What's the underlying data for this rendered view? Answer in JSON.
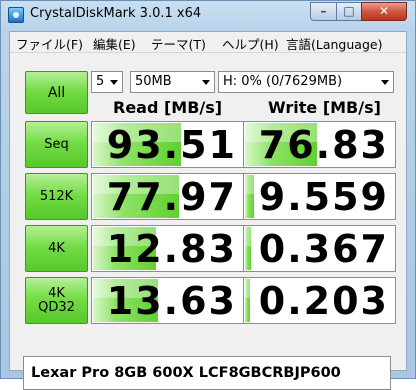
{
  "window": {
    "title": "CrystalDiskMark 3.0.1 x64"
  },
  "menu": [
    "ファイル(F)",
    "編集(E)",
    "テーマ(T)",
    "ヘルプ(H)",
    "言語(Language)"
  ],
  "controls": {
    "all_label": "All",
    "runs": "5",
    "size": "50MB",
    "drive": "H: 0% (0/7629MB)"
  },
  "headers": {
    "read": "Read [MB/s]",
    "write": "Write [MB/s]"
  },
  "tests": [
    {
      "label": "Seq",
      "read": "93.51",
      "write": "76.83",
      "read_fill": 0.58,
      "write_fill": 0.48
    },
    {
      "label": "512K",
      "read": "77.97",
      "write": "9.559",
      "read_fill": 0.57,
      "write_fill": 0.06
    },
    {
      "label": "4K",
      "read": "12.83",
      "write": "0.367",
      "read_fill": 0.42,
      "write_fill": 0.04
    },
    {
      "label": "4K\nQD32",
      "read": "13.63",
      "write": "0.203",
      "read_fill": 0.43,
      "write_fill": 0.03
    }
  ],
  "comment": "Lexar Pro 8GB 600X LCF8GBCRBJP600",
  "colors": {
    "bar_green": "#5fd12f",
    "button_green": "#74dc46",
    "close_red": "#c8452b"
  }
}
